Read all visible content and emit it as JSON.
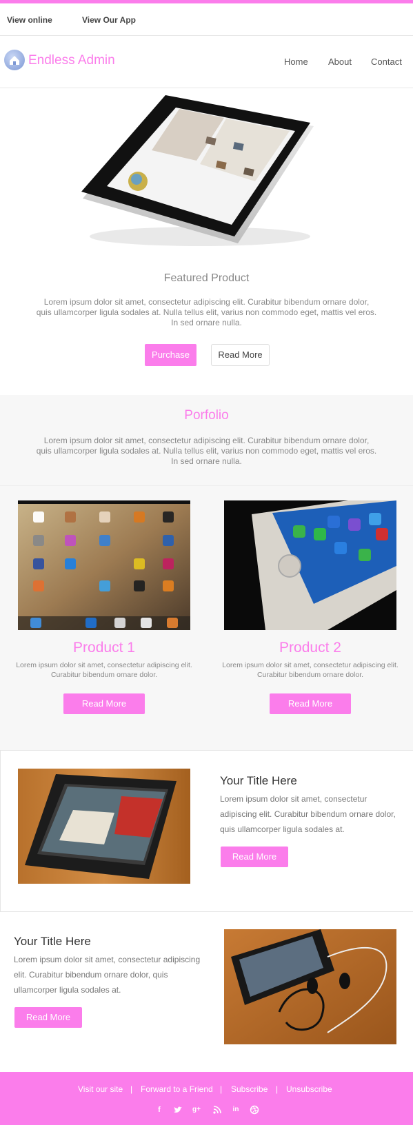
{
  "topbar": {
    "view_online": "View online",
    "view_app": "View Our App"
  },
  "header": {
    "brand": "Endless Admin",
    "nav": [
      "Home",
      "About",
      "Contact"
    ]
  },
  "featured": {
    "title": "Featured Product",
    "text": "Lorem ipsum dolor sit amet, consectetur adipiscing elit. Curabitur bibendum ornare dolor, quis ullamcorper ligula sodales at. Nulla tellus elit, varius non commodo eget, mattis vel eros. In sed ornare nulla.",
    "purchase": "Purchase",
    "read_more": "Read More"
  },
  "portfolio": {
    "title": "Porfolio",
    "text": "Lorem ipsum dolor sit amet, consectetur adipiscing elit. Curabitur bibendum ornare dolor, quis ullamcorper ligula sodales at. Nulla tellus elit, varius non commodo eget, mattis vel eros. In sed ornare nulla."
  },
  "products": [
    {
      "title": "Product 1",
      "text": "Lorem ipsum dolor sit amet, consectetur adipiscing elit. Curabitur bibendum ornare dolor.",
      "button": "Read More"
    },
    {
      "title": "Product 2",
      "text": "Lorem ipsum dolor sit amet, consectetur adipiscing elit. Curabitur bibendum ornare dolor.",
      "button": "Read More"
    }
  ],
  "sections": [
    {
      "title": "Your Title Here",
      "text": "Lorem ipsum dolor sit amet, consectetur adipiscing elit. Curabitur bibendum ornare dolor, quis ullamcorper ligula sodales at.",
      "button": "Read More"
    },
    {
      "title": "Your Title Here",
      "text": "Lorem ipsum dolor sit amet, consectetur adipiscing elit. Curabitur bibendum ornare dolor, quis ullamcorper ligula sodales at.",
      "button": "Read More"
    }
  ],
  "footer": {
    "links": [
      "Visit our site",
      "Forward to a Friend",
      "Subscribe",
      "Unsubscribe"
    ],
    "separator": "|",
    "social_icons": [
      "facebook-icon",
      "twitter-icon",
      "google-plus-icon",
      "rss-icon",
      "linkedin-icon",
      "dribbble-icon"
    ]
  },
  "colors": {
    "accent": "#fb7deb",
    "band": "#f7f7f7"
  }
}
